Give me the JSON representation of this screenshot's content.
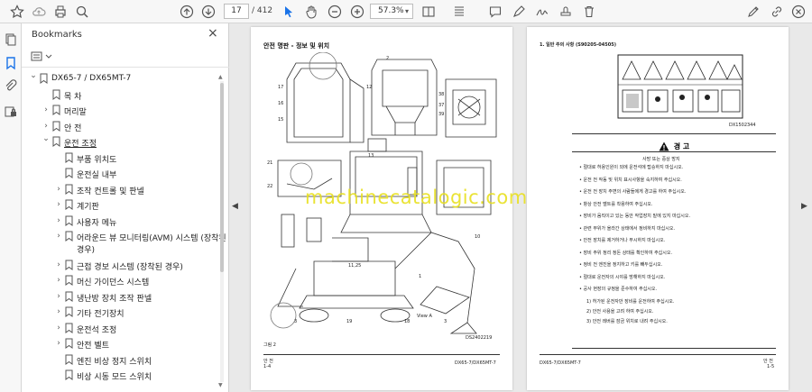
{
  "toolbar": {
    "current_page": "17",
    "page_count": "/ 412",
    "zoom": "57.3%"
  },
  "bookmarks_panel": {
    "title": "Bookmarks",
    "items": [
      {
        "label": "DX65-7 / DX65MT-7",
        "level": 0,
        "caret": "down"
      },
      {
        "label": "목 차",
        "level": 1,
        "caret": "none"
      },
      {
        "label": "머리말",
        "level": 1,
        "caret": "right"
      },
      {
        "label": "안 전",
        "level": 1,
        "caret": "right"
      },
      {
        "label": "운전 조정",
        "level": 1,
        "caret": "down",
        "underline": true
      },
      {
        "label": "부품 위치도",
        "level": 2,
        "caret": "none"
      },
      {
        "label": "운전실 내부",
        "level": 2,
        "caret": "none"
      },
      {
        "label": "조작 컨트롤 및 판넬",
        "level": 2,
        "caret": "right"
      },
      {
        "label": "계기판",
        "level": 2,
        "caret": "right"
      },
      {
        "label": "사용자 메뉴",
        "level": 2,
        "caret": "right"
      },
      {
        "label": "어라운드 뷰 모니터링(AVM) 시스템 (장착된",
        "label2": "경우)",
        "level": 2,
        "caret": "right"
      },
      {
        "label": "근접 경보 시스템 (장착된 경우)",
        "level": 2,
        "caret": "right"
      },
      {
        "label": "머신 가이던스 시스템",
        "level": 2,
        "caret": "right"
      },
      {
        "label": "냉난방 장치 조작 판넬",
        "level": 2,
        "caret": "right"
      },
      {
        "label": "기타 전기장치",
        "level": 2,
        "caret": "right"
      },
      {
        "label": "운전석 조정",
        "level": 2,
        "caret": "right"
      },
      {
        "label": "안전 벨트",
        "level": 2,
        "caret": "right"
      },
      {
        "label": "엔진 비상 정지 스위치",
        "level": 2,
        "caret": "none"
      },
      {
        "label": "비상 시동 모드 스위치",
        "level": 2,
        "caret": "none"
      }
    ]
  },
  "document": {
    "left_page": {
      "title": "안전 명판 - 정보 및 위치",
      "figure_label": "그림 2",
      "figure_code": "DS2402219",
      "footer_left": "안 전",
      "footer_page": "1-4",
      "footer_right": "DX65-7/DX65MT-7",
      "view_a": "View A"
    },
    "right_page": {
      "heading": "1.   일반 주의 사항 (S90205-04505)",
      "figure_code": "DX1502344",
      "warning_title": "경 고",
      "lines": [
        "사망 또는 중상 방지",
        "•   절대로 허용인원이 외에 운전석에 탑승하지 마십시오.",
        "•   운전 전 작동 및 위치 표시사항을 숙지하여 주십시오.",
        "•   운전 전 장치 주변의 사람들에게 경고를 하여 주십시오.",
        "•   항상 안전 벨트를 착용하여 주십시오.",
        "•   장비가 움직이고 있는 동안 작업장치 밑에 있지 마십시오.",
        "•   관련 부위가 올라간 상태에서 정비하지 마십시오.",
        "•   안전 장치를 제거하거나 무시하지 마십시오.",
        "•   장비 주위 정리 정돈 상태를 확인하여 주십시오.",
        "•   정비 전 엔진을 정지하고 키를 빼두십시오.",
        "•   절대로 운전자의 시야를 방해하지 마십시오.",
        "•   공사 현장의 규정을 준수하여 주십시오."
      ],
      "sub_items": [
        "1)   허가된 운전자만 장비를 운전하여 주십시오.",
        "2)   안전 사용을 고려 하여 주십시오.",
        "3)   안전 레버를 잠금 위치로 내려 주십시오."
      ],
      "footer_left": "DX65-7/DX65MT-7",
      "footer_right": "안 전",
      "footer_page": "1-5"
    },
    "watermark": "machinecatalogic.com"
  },
  "colors": {
    "accent": "#1a73e8",
    "watermark": "#e8e020"
  }
}
